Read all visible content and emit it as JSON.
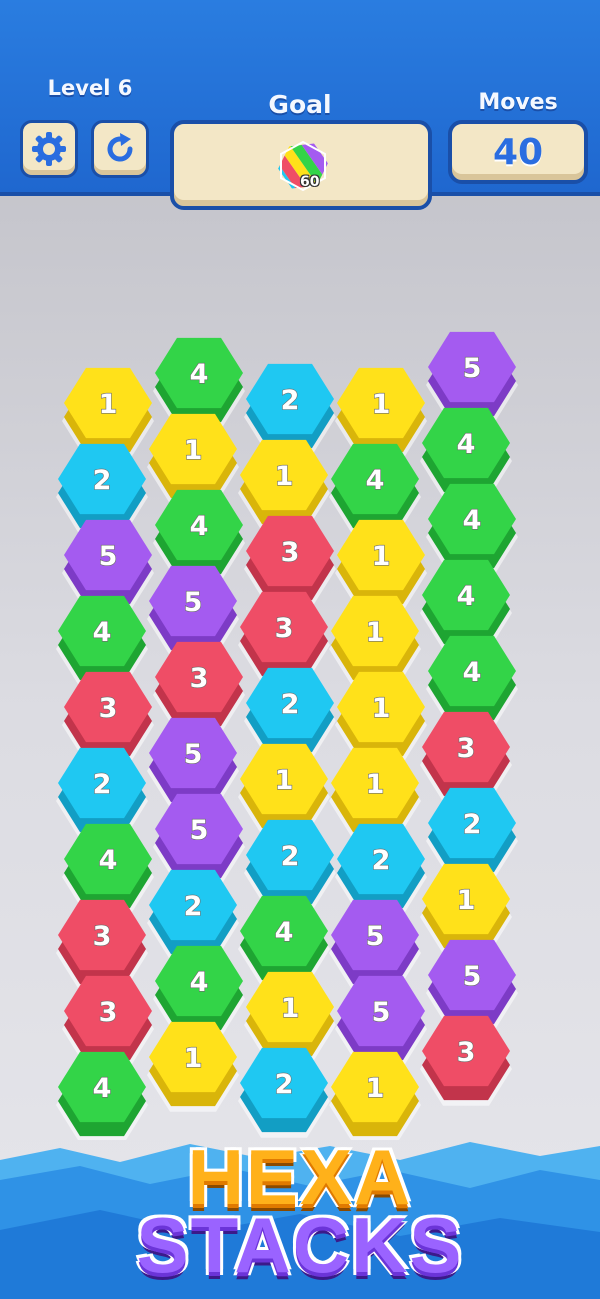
{
  "header": {
    "level_label": "Level 6",
    "goal_label": "Goal",
    "moves_label": "Moves",
    "moves_value": "40",
    "goal_count": "60",
    "settings_icon": "gear-icon",
    "restart_icon": "restart-icon",
    "goal_icon": "multicolor-hex-icon"
  },
  "colors": {
    "yellow": "#ffe11a",
    "green": "#33d448",
    "blue": "#1fc8f2",
    "red": "#ef4d66",
    "purple": "#a45bf0"
  },
  "board": {
    "tiles": [
      {
        "col": 0,
        "row": 0,
        "color": "yellow",
        "value": "1"
      },
      {
        "col": 1,
        "row": 0,
        "color": "green",
        "value": "4"
      },
      {
        "col": 2,
        "row": 0,
        "color": "blue",
        "value": "2"
      },
      {
        "col": 3,
        "row": 0,
        "color": "yellow",
        "value": "1"
      },
      {
        "col": 4,
        "row": 0,
        "color": "purple",
        "value": "5"
      },
      {
        "col": 0,
        "row": 1,
        "color": "blue",
        "value": "2"
      },
      {
        "col": 1,
        "row": 1,
        "color": "yellow",
        "value": "1"
      },
      {
        "col": 2,
        "row": 1,
        "color": "yellow",
        "value": "1"
      },
      {
        "col": 3,
        "row": 1,
        "color": "green",
        "value": "4"
      },
      {
        "col": 4,
        "row": 1,
        "color": "green",
        "value": "4"
      },
      {
        "col": 0,
        "row": 2,
        "color": "purple",
        "value": "5"
      },
      {
        "col": 1,
        "row": 2,
        "color": "green",
        "value": "4"
      },
      {
        "col": 2,
        "row": 2,
        "color": "red",
        "value": "3"
      },
      {
        "col": 3,
        "row": 2,
        "color": "yellow",
        "value": "1"
      },
      {
        "col": 4,
        "row": 2,
        "color": "green",
        "value": "4"
      },
      {
        "col": 0,
        "row": 3,
        "color": "green",
        "value": "4"
      },
      {
        "col": 1,
        "row": 3,
        "color": "purple",
        "value": "5"
      },
      {
        "col": 2,
        "row": 3,
        "color": "red",
        "value": "3"
      },
      {
        "col": 3,
        "row": 3,
        "color": "yellow",
        "value": "1"
      },
      {
        "col": 4,
        "row": 3,
        "color": "green",
        "value": "4"
      },
      {
        "col": 0,
        "row": 4,
        "color": "red",
        "value": "3"
      },
      {
        "col": 1,
        "row": 4,
        "color": "red",
        "value": "3"
      },
      {
        "col": 2,
        "row": 4,
        "color": "blue",
        "value": "2"
      },
      {
        "col": 3,
        "row": 4,
        "color": "yellow",
        "value": "1"
      },
      {
        "col": 4,
        "row": 4,
        "color": "green",
        "value": "4"
      },
      {
        "col": 0,
        "row": 5,
        "color": "blue",
        "value": "2"
      },
      {
        "col": 1,
        "row": 5,
        "color": "purple",
        "value": "5"
      },
      {
        "col": 2,
        "row": 5,
        "color": "yellow",
        "value": "1"
      },
      {
        "col": 3,
        "row": 5,
        "color": "yellow",
        "value": "1"
      },
      {
        "col": 4,
        "row": 5,
        "color": "red",
        "value": "3"
      },
      {
        "col": 0,
        "row": 6,
        "color": "green",
        "value": "4"
      },
      {
        "col": 1,
        "row": 6,
        "color": "purple",
        "value": "5"
      },
      {
        "col": 2,
        "row": 6,
        "color": "blue",
        "value": "2"
      },
      {
        "col": 3,
        "row": 6,
        "color": "blue",
        "value": "2"
      },
      {
        "col": 4,
        "row": 6,
        "color": "blue",
        "value": "2"
      },
      {
        "col": 0,
        "row": 7,
        "color": "red",
        "value": "3"
      },
      {
        "col": 1,
        "row": 7,
        "color": "blue",
        "value": "2"
      },
      {
        "col": 2,
        "row": 7,
        "color": "green",
        "value": "4"
      },
      {
        "col": 3,
        "row": 7,
        "color": "purple",
        "value": "5"
      },
      {
        "col": 4,
        "row": 7,
        "color": "yellow",
        "value": "1"
      },
      {
        "col": 0,
        "row": 8,
        "color": "red",
        "value": "3"
      },
      {
        "col": 1,
        "row": 8,
        "color": "green",
        "value": "4"
      },
      {
        "col": 2,
        "row": 8,
        "color": "yellow",
        "value": "1"
      },
      {
        "col": 3,
        "row": 8,
        "color": "purple",
        "value": "5"
      },
      {
        "col": 4,
        "row": 8,
        "color": "purple",
        "value": "5"
      },
      {
        "col": 0,
        "row": 9,
        "color": "green",
        "value": "4"
      },
      {
        "col": 1,
        "row": 9,
        "color": "yellow",
        "value": "1"
      },
      {
        "col": 2,
        "row": 9,
        "color": "blue",
        "value": "2"
      },
      {
        "col": 3,
        "row": 9,
        "color": "yellow",
        "value": "1"
      },
      {
        "col": 4,
        "row": 9,
        "color": "red",
        "value": "3"
      }
    ]
  },
  "brand": {
    "line1": "HEXA",
    "line2": "STACKS"
  }
}
